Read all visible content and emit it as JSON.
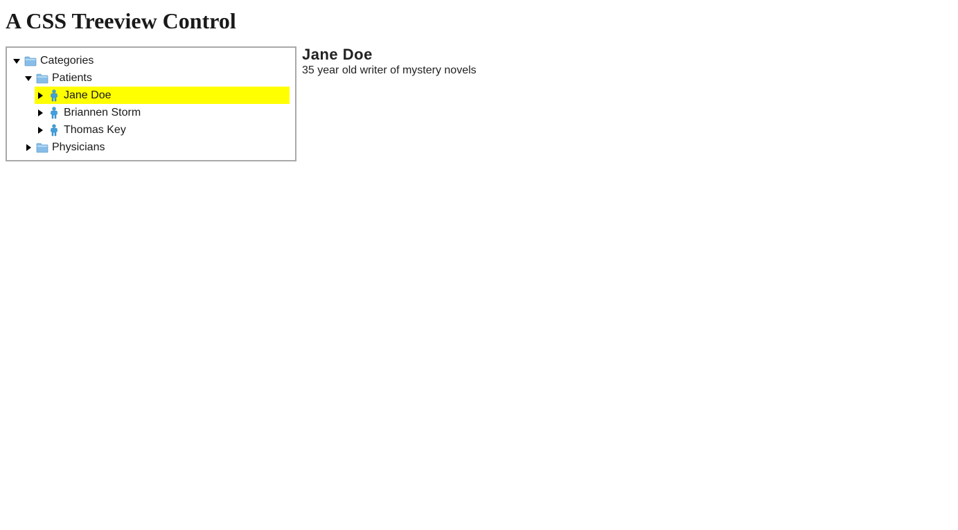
{
  "page": {
    "title": "A CSS Treeview Control"
  },
  "tree": {
    "root": {
      "label": "Categories",
      "children": {
        "patients": {
          "label": "Patients",
          "items": {
            "0": {
              "label": "Jane Doe"
            },
            "1": {
              "label": "Briannen Storm"
            },
            "2": {
              "label": "Thomas Key"
            }
          }
        },
        "physicians": {
          "label": "Physicians"
        }
      }
    }
  },
  "details": {
    "title": "Jane Doe",
    "description": "35 year old writer of mystery novels"
  },
  "colors": {
    "highlight": "#ffff00",
    "border": "#a9a9a9",
    "iconBlue": "#63a5d6"
  }
}
